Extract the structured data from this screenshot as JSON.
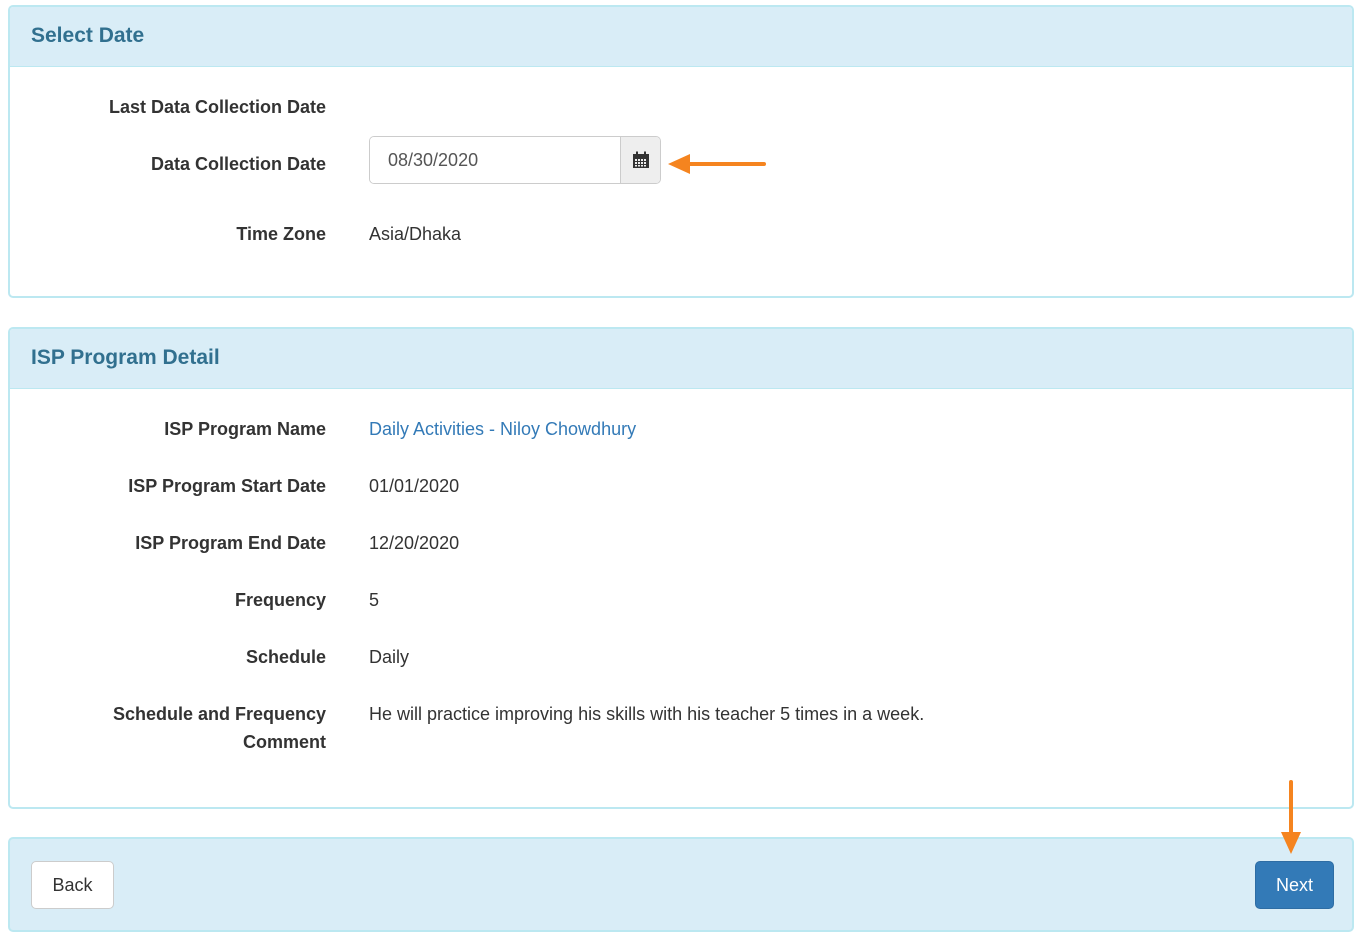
{
  "select_date": {
    "title": "Select Date",
    "last_collection_label": "Last Data Collection Date",
    "last_collection_value": "",
    "collection_date_label": "Data Collection Date",
    "collection_date_value": "08/30/2020",
    "timezone_label": "Time Zone",
    "timezone_value": "Asia/Dhaka"
  },
  "program": {
    "title": "ISP Program Detail",
    "name_label": "ISP Program Name",
    "name_value": "Daily Activities - Niloy Chowdhury",
    "start_label": "ISP Program Start Date",
    "start_value": "01/01/2020",
    "end_label": "ISP Program End Date",
    "end_value": "12/20/2020",
    "frequency_label": "Frequency",
    "frequency_value": "5",
    "schedule_label": "Schedule",
    "schedule_value": "Daily",
    "comment_label_line1": "Schedule and Frequency",
    "comment_label_line2": "Comment",
    "comment_value": "He will practice improving his skills with his teacher 5 times in a week."
  },
  "footer": {
    "back_label": "Back",
    "next_label": "Next"
  },
  "icons": {
    "calendar": "calendar-icon",
    "annotation": "arrow-icon"
  },
  "colors": {
    "heading_bg": "#d9edf7",
    "heading_text": "#31708f",
    "border": "#bce8f1",
    "link": "#337ab7",
    "primary": "#337ab7",
    "annotation": "#f5841f"
  }
}
